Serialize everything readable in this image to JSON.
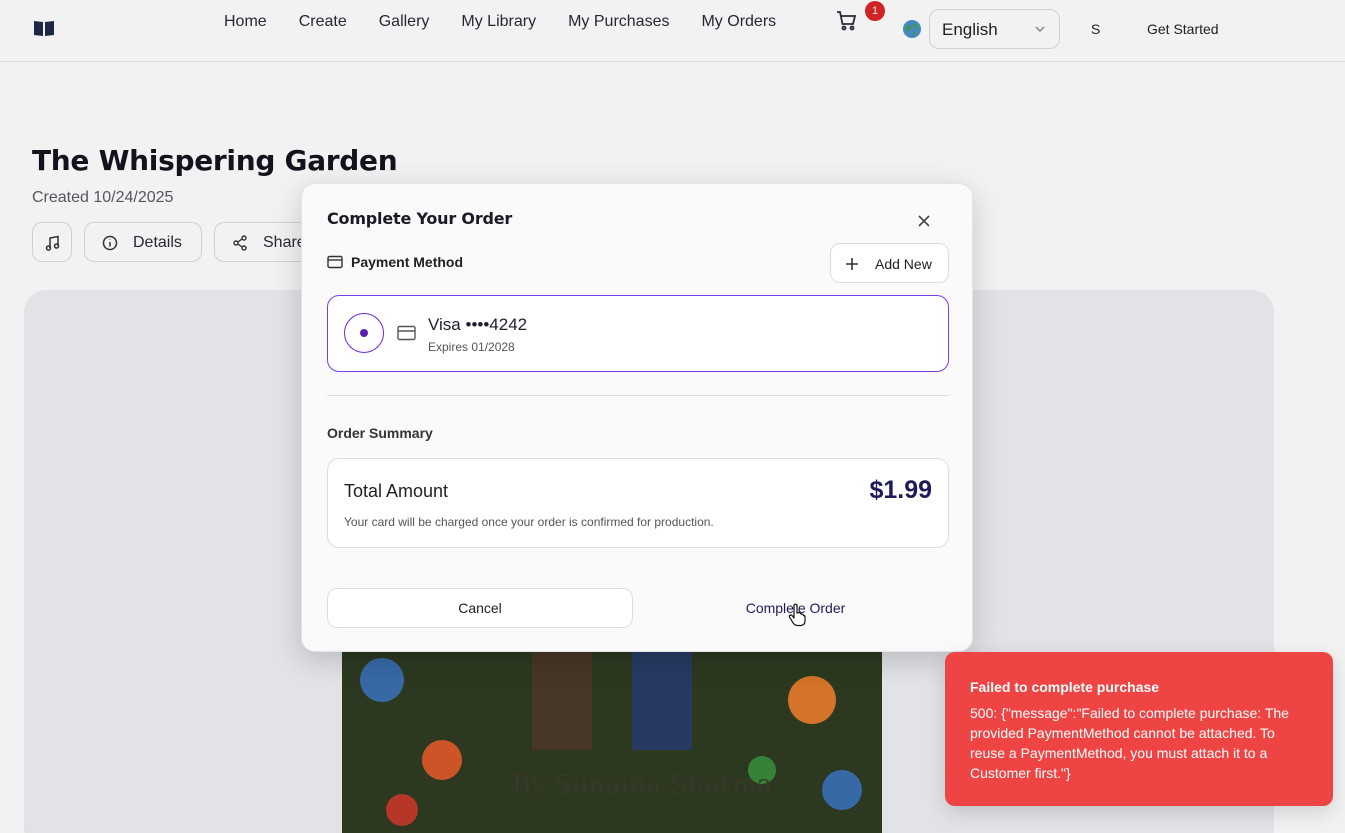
{
  "header": {
    "nav": [
      "Home",
      "Create",
      "Gallery",
      "My Library",
      "My Purchases",
      "My Orders"
    ],
    "cart_count": "1",
    "language": "English",
    "user_initial": "S",
    "get_started": "Get Started"
  },
  "page": {
    "title": "The Whispering Garden",
    "created": "Created 10/24/2025",
    "details_label": "Details",
    "share_label": "Share",
    "cover_author": "By Sunaina Sharma"
  },
  "modal": {
    "title": "Complete Your Order",
    "payment_method_label": "Payment Method",
    "add_new_label": "Add New",
    "card": {
      "name": "Visa ••••4242",
      "expires": "Expires 01/2028",
      "selected": true
    },
    "order_summary_label": "Order Summary",
    "total_label": "Total Amount",
    "total_amount": "$1.99",
    "charge_note": "Your card will be charged once your order is confirmed for production.",
    "cancel_label": "Cancel",
    "complete_label": "Complete Order"
  },
  "toast": {
    "title": "Failed to complete purchase",
    "message": "500: {\"message\":\"Failed to complete purchase: The provided PaymentMethod cannot be attached. To reuse a PaymentMethod, you must attach it to a Customer first.\"}"
  },
  "colors": {
    "accent": "#7c3aed",
    "error": "#ef4444",
    "price": "#1e1b5a"
  }
}
